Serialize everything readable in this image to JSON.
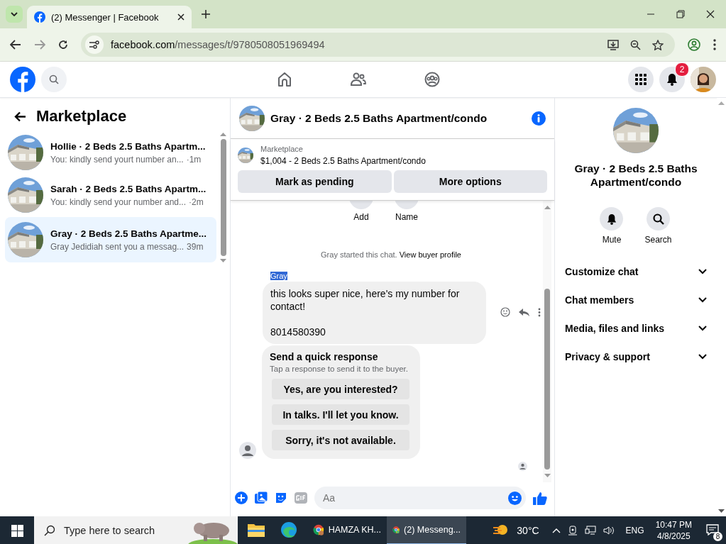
{
  "browser": {
    "tabs": [
      {
        "title": "(2) Messenger | Facebook",
        "selected": true
      }
    ],
    "url_domain": "facebook.com",
    "url_path": "/messages/t/9780508051969494"
  },
  "header": {
    "notification_count": "2"
  },
  "sidebar": {
    "title": "Marketplace",
    "conversations": [
      {
        "name": "Hollie · 2 Beds 2.5 Baths Apartm...",
        "preview": "You: kindly send yourt number an...",
        "time": "·1m",
        "selected": false
      },
      {
        "name": "Sarah · 2 Beds 2.5 Baths Apartm...",
        "preview": "You: kindly send your number and...",
        "time": "·2m",
        "selected": false
      },
      {
        "name": "Gray · 2 Beds 2.5 Baths Apartme...",
        "preview": "Gray Jedidiah sent you a messag...",
        "time": "39m",
        "selected": true
      }
    ]
  },
  "chat": {
    "title": "Gray · 2 Beds 2.5 Baths Apartment/condo",
    "listing": {
      "label": "Marketplace",
      "description": "$1,004 - 2 Beds 2.5 Baths Apartment/condo"
    },
    "listing_actions": [
      "Mark as pending",
      "More options"
    ],
    "quick_actions": [
      "Add",
      "Name"
    ],
    "system_message": {
      "text": "Gray started this chat.",
      "link": "View buyer profile"
    },
    "sender": {
      "name": "Gray",
      "highlighted": true
    },
    "message": [
      "this looks super nice, here's my number for contact!",
      "8014580390"
    ],
    "quick_response": {
      "title": "Send a quick response",
      "hint": "Tap a response to send it to the buyer.",
      "options": [
        "Yes, are you interested?",
        "In talks. I'll let you know.",
        "Sorry, it's not available."
      ]
    },
    "composer": {
      "placeholder": "Aa"
    }
  },
  "details": {
    "title": "Gray · 2 Beds 2.5 Baths Apartment/condo",
    "actions": [
      "Mute",
      "Search"
    ],
    "sections": [
      {
        "label": "Customize chat",
        "expanded": false
      },
      {
        "label": "Chat members",
        "expanded": false
      },
      {
        "label": "Media, files and links",
        "expanded": false
      },
      {
        "label": "Privacy & support",
        "expanded": false
      }
    ]
  },
  "taskbar": {
    "search_placeholder": "Type here to search",
    "apps": [
      {
        "label": "HAMZA KH...",
        "selected": false
      },
      {
        "label": "(2) Messeng...",
        "selected": true
      }
    ],
    "weather": "30°C",
    "language": "ENG",
    "time": "10:47 PM",
    "date": "4/8/2025",
    "notification_count": "8"
  }
}
